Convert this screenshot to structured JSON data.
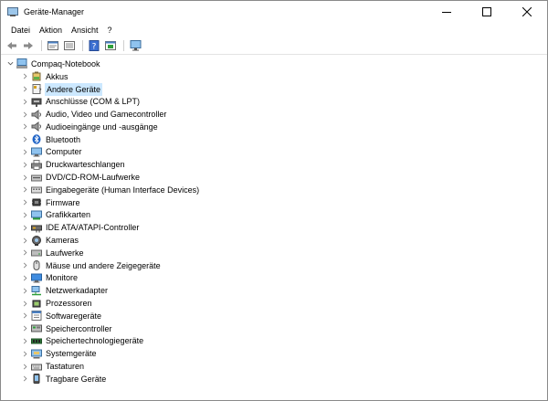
{
  "window": {
    "title": "Geräte-Manager"
  },
  "menu": [
    "Datei",
    "Aktion",
    "Ansicht",
    "?"
  ],
  "toolbar": [
    "back-icon",
    "forward-icon",
    "properties-icon",
    "list-view-icon",
    "help-icon",
    "update-driver-icon",
    "scan-hardware-icon"
  ],
  "tree": {
    "root": "Compaq-Notebook",
    "selected": "Andere Geräte",
    "children": [
      {
        "label": "Akkus",
        "icon": "battery-icon"
      },
      {
        "label": "Andere Geräte",
        "icon": "unknown-device-icon"
      },
      {
        "label": "Anschlüsse (COM & LPT)",
        "icon": "port-icon"
      },
      {
        "label": "Audio, Video und Gamecontroller",
        "icon": "speaker-icon"
      },
      {
        "label": "Audioeingänge und -ausgänge",
        "icon": "speaker-icon"
      },
      {
        "label": "Bluetooth",
        "icon": "bluetooth-icon"
      },
      {
        "label": "Computer",
        "icon": "computer-icon"
      },
      {
        "label": "Druckwarteschlangen",
        "icon": "printer-icon"
      },
      {
        "label": "DVD/CD-ROM-Laufwerke",
        "icon": "dvd-icon"
      },
      {
        "label": "Eingabegeräte (Human Interface Devices)",
        "icon": "hid-icon"
      },
      {
        "label": "Firmware",
        "icon": "chip-icon"
      },
      {
        "label": "Grafikkarten",
        "icon": "display-adapter-icon"
      },
      {
        "label": "IDE ATA/ATAPI-Controller",
        "icon": "controller-icon"
      },
      {
        "label": "Kameras",
        "icon": "camera-icon"
      },
      {
        "label": "Laufwerke",
        "icon": "drive-icon"
      },
      {
        "label": "Mäuse und andere Zeigegeräte",
        "icon": "mouse-icon"
      },
      {
        "label": "Monitore",
        "icon": "monitor-icon"
      },
      {
        "label": "Netzwerkadapter",
        "icon": "network-icon"
      },
      {
        "label": "Prozessoren",
        "icon": "cpu-icon"
      },
      {
        "label": "Softwaregeräte",
        "icon": "software-device-icon"
      },
      {
        "label": "Speichercontroller",
        "icon": "storage-controller-icon"
      },
      {
        "label": "Speichertechnologiegeräte",
        "icon": "memory-device-icon"
      },
      {
        "label": "Systemgeräte",
        "icon": "system-device-icon"
      },
      {
        "label": "Tastaturen",
        "icon": "keyboard-icon"
      },
      {
        "label": "Tragbare Geräte",
        "icon": "portable-device-icon"
      }
    ]
  }
}
